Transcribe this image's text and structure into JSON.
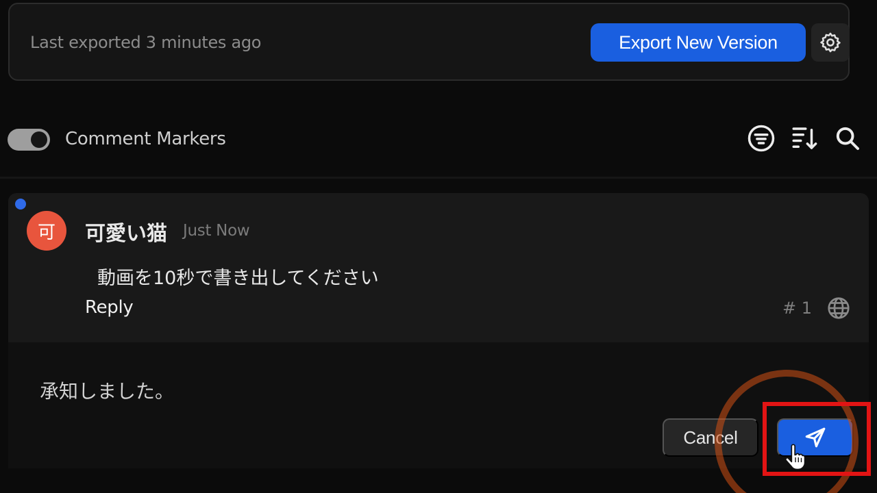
{
  "export_bar": {
    "status": "Last exported 3 minutes ago",
    "export_button": "Export New Version"
  },
  "toolbar": {
    "toggle_label": "Comment Markers",
    "toggle_on": true,
    "icons": [
      "filter-icon",
      "sort-icon",
      "search-icon"
    ]
  },
  "comment": {
    "avatar_initial": "可",
    "author": "可愛い猫",
    "timestamp": "Just Now",
    "text": "動画を10秒で書き出してください",
    "reply_label": "Reply",
    "number": "# 1"
  },
  "composer": {
    "value": "承知しました。",
    "cancel_label": "Cancel"
  },
  "colors": {
    "accent": "#1a5fe0",
    "avatar": "#e8553d",
    "unread_dot": "#2f6ae8",
    "highlight": "#e21414"
  }
}
